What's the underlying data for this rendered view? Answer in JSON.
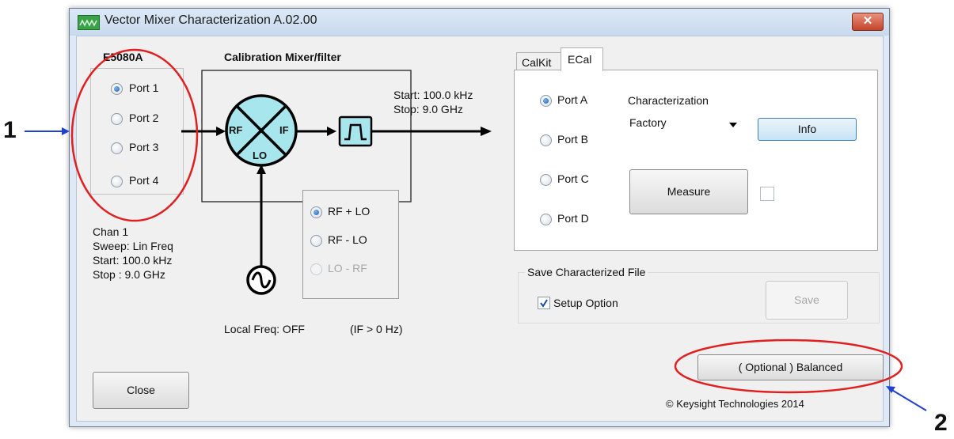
{
  "window": {
    "title": "Vector Mixer Characterization A.02.00",
    "close_glyph": "✕"
  },
  "port_panel": {
    "title": "E5080A",
    "ports": [
      {
        "label": "Port 1",
        "selected": true
      },
      {
        "label": "Port 2",
        "selected": false
      },
      {
        "label": "Port 3",
        "selected": false
      },
      {
        "label": "Port 4",
        "selected": false
      }
    ]
  },
  "channel_info": {
    "chan": "Chan 1",
    "sweep": "Sweep: Lin Freq",
    "start": "Start: 100.0 kHz",
    "stop": "Stop : 9.0 GHz"
  },
  "mixer_diagram": {
    "title": "Calibration Mixer/filter",
    "rf_label": "RF",
    "if_label": "IF",
    "lo_label": "LO",
    "output_start": "Start: 100.0 kHz",
    "output_stop": "Stop: 9.0 GHz",
    "local_freq": "Local Freq: OFF",
    "if_condition": "(IF > 0 Hz)",
    "mix_options": [
      {
        "label": "RF + LO",
        "selected": true,
        "enabled": true
      },
      {
        "label": "RF - LO",
        "selected": false,
        "enabled": true
      },
      {
        "label": "LO - RF",
        "selected": false,
        "enabled": false
      }
    ]
  },
  "tabs": [
    {
      "label": "CalKit",
      "active": false
    },
    {
      "label": "ECal",
      "active": true
    }
  ],
  "ecal": {
    "ports": [
      {
        "label": "Port A",
        "selected": true
      },
      {
        "label": "Port B",
        "selected": false
      },
      {
        "label": "Port C",
        "selected": false
      },
      {
        "label": "Port D",
        "selected": false
      }
    ],
    "characterization_label": "Characterization",
    "characterization_value": "Factory",
    "info_button": "Info",
    "measure_button": "Measure",
    "measure_checked": false
  },
  "save_section": {
    "title": "Save Characterized File",
    "setup_option_label": "Setup Option",
    "setup_option_checked": true,
    "save_button": "Save"
  },
  "balanced_button": "( Optional ) Balanced",
  "close_button": "Close",
  "copyright": "© Keysight Technologies 2014",
  "annotations": {
    "marker_1": "1",
    "marker_2": "2",
    "ellipse_color": "#e02020",
    "arrow_color": "#2040d0"
  }
}
